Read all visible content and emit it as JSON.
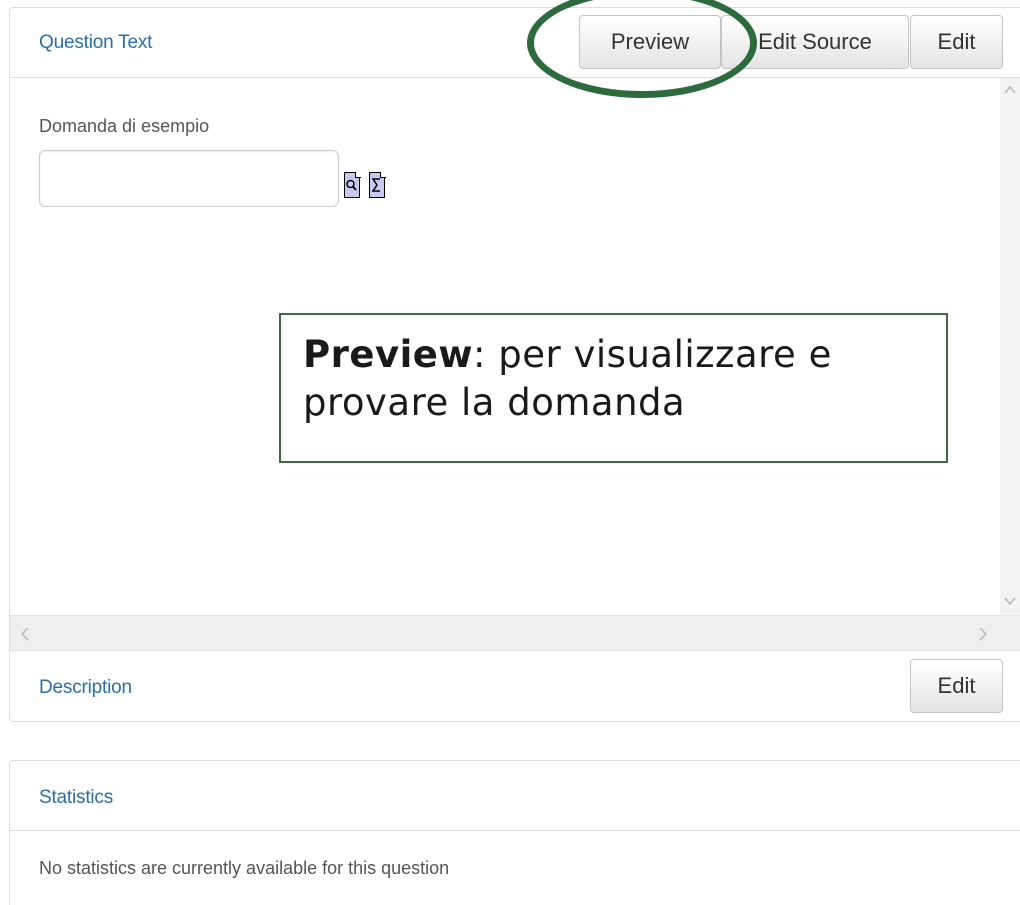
{
  "question_panel": {
    "title": "Question Text",
    "preview_label": "Preview",
    "edit_source_label": "Edit Source",
    "edit_label": "Edit",
    "prompt": "Domanda di esempio",
    "answer_value": "",
    "preview_icon": "magnifier-doc-icon",
    "equation_icon": "sigma-doc-icon",
    "scroll_left_glyph": "<",
    "scroll_right_glyph": ">",
    "scroll_up_glyph": "^",
    "scroll_down_glyph": "v"
  },
  "description_panel": {
    "title": "Description",
    "edit_label": "Edit"
  },
  "statistics_panel": {
    "title": "Statistics",
    "message": "No statistics are currently available for this question"
  },
  "annotation": {
    "callout_bold": "Preview",
    "callout_text": ": per visualizzare e provare la domanda",
    "highlight_color": "#2d6a3e"
  },
  "colors": {
    "link_blue": "#2a6ea8",
    "annotation_green": "#3e6b3e"
  }
}
